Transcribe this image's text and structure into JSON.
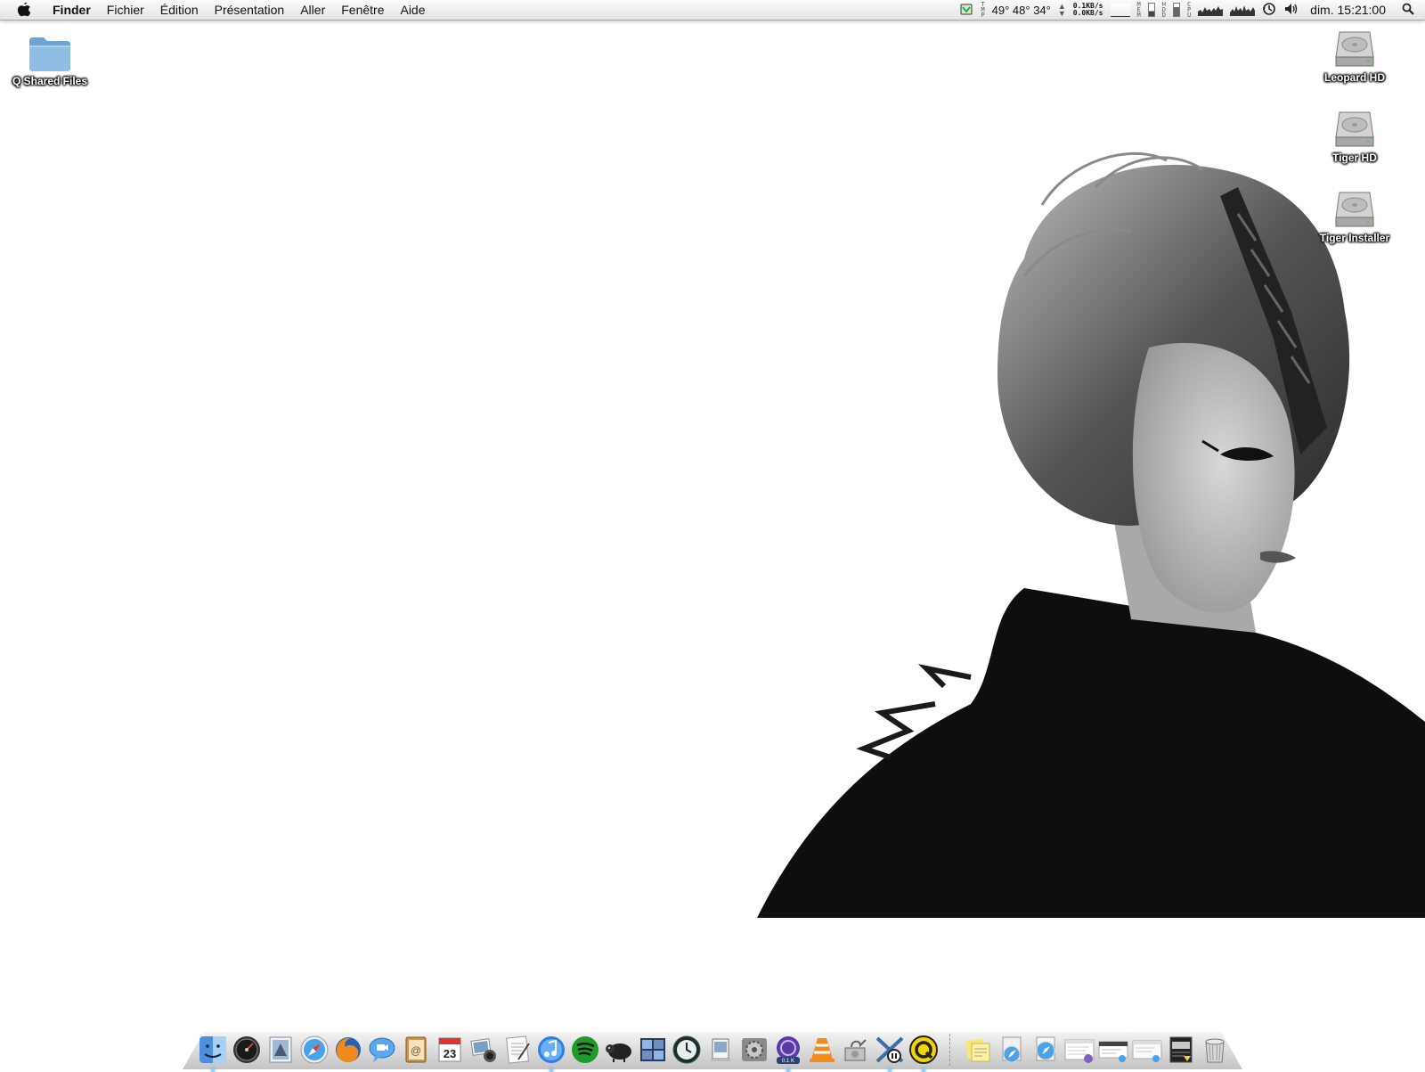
{
  "menubar": {
    "apple_icon": "apple-logo",
    "items": [
      "Finder",
      "Fichier",
      "Édition",
      "Présentation",
      "Aller",
      "Fenêtre",
      "Aide"
    ],
    "status": {
      "temps": "49° 48° 34°",
      "tmp_label": [
        "T",
        "M",
        "P"
      ],
      "net_up": "0.1KB/s",
      "net_down": "0.0KB/s",
      "mem_label": [
        "M",
        "E",
        "M"
      ],
      "hdd_label": [
        "H",
        "D",
        "D"
      ],
      "cpu_label": [
        "C",
        "P",
        "U"
      ],
      "clock": "dim. 15:21:00",
      "icons": [
        "istat-icon",
        "time-machine-icon",
        "volume-icon",
        "spotlight-icon"
      ]
    }
  },
  "desktop": {
    "left_icons": [
      {
        "label": "Q Shared Files",
        "icon": "folder-icon"
      }
    ],
    "right_icons": [
      {
        "label": "Leopard HD",
        "icon": "hard-drive-icon"
      },
      {
        "label": "Tiger HD",
        "icon": "hard-drive-icon"
      },
      {
        "label": "Tiger Installer",
        "icon": "hard-drive-icon"
      }
    ],
    "wallpaper": "black-and-white portrait photograph"
  },
  "dock": {
    "calendar_day": "23",
    "transmission_rate": "0.1 K",
    "apps": [
      {
        "icon": "finder-icon",
        "running": true
      },
      {
        "icon": "dashboard-icon",
        "running": false
      },
      {
        "icon": "mail-stamp-icon",
        "running": false
      },
      {
        "icon": "safari-icon",
        "running": false
      },
      {
        "icon": "firefox-icon",
        "running": false
      },
      {
        "icon": "ichat-icon",
        "running": false
      },
      {
        "icon": "address-book-icon",
        "running": false
      },
      {
        "icon": "ical-icon",
        "running": false
      },
      {
        "icon": "iphoto-icon",
        "running": false
      },
      {
        "icon": "textedit-icon",
        "running": false
      },
      {
        "icon": "itunes-icon",
        "running": true
      },
      {
        "icon": "spotify-icon",
        "running": false
      },
      {
        "icon": "sheepshaver-icon",
        "running": false
      },
      {
        "icon": "spaces-icon",
        "running": false
      },
      {
        "icon": "time-machine-icon",
        "running": false
      },
      {
        "icon": "preview-icon",
        "running": false
      },
      {
        "icon": "system-preferences-icon",
        "running": false
      },
      {
        "icon": "transmission-icon",
        "running": true
      },
      {
        "icon": "vlc-icon",
        "running": false
      },
      {
        "icon": "disk-utility-icon",
        "running": false
      },
      {
        "icon": "growl-icon",
        "running": true
      },
      {
        "icon": "quicksilver-icon",
        "running": true
      }
    ],
    "docs": [
      {
        "icon": "stickies-icon"
      },
      {
        "icon": "safari-stack-icon"
      },
      {
        "icon": "safari-downloads-icon"
      },
      {
        "icon": "window-thumb-1-icon"
      },
      {
        "icon": "window-thumb-2-icon"
      },
      {
        "icon": "window-thumb-3-icon"
      },
      {
        "icon": "window-thumb-4-icon"
      },
      {
        "icon": "trash-icon"
      }
    ]
  },
  "colors": {
    "menubar_top": "#fbfbfb",
    "menubar_bottom": "#e4e4e4",
    "desktop_bg": "#ffffff",
    "folder_blue": "#7fb2dc",
    "dock_shelf": "#d0d0d0"
  }
}
